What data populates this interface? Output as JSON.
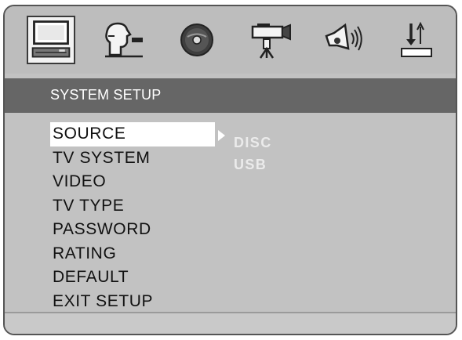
{
  "icons": [
    {
      "name": "system-monitor-icon",
      "active": true
    },
    {
      "name": "language-profile-icon",
      "active": false
    },
    {
      "name": "disc-icon",
      "active": false
    },
    {
      "name": "camera-icon",
      "active": false
    },
    {
      "name": "speaker-icon",
      "active": false
    },
    {
      "name": "sort-icon",
      "active": false
    }
  ],
  "header": {
    "title": "SYSTEM SETUP"
  },
  "menu": {
    "items": [
      {
        "label": "SOURCE",
        "selected": true
      },
      {
        "label": "TV SYSTEM"
      },
      {
        "label": "VIDEO"
      },
      {
        "label": "TV TYPE"
      },
      {
        "label": "PASSWORD"
      },
      {
        "label": "RATING"
      },
      {
        "label": "DEFAULT"
      },
      {
        "label": "EXIT SETUP"
      }
    ]
  },
  "submenu": {
    "items": [
      "DISC",
      "USB"
    ]
  },
  "colors": {
    "panel": "#c2c2c2",
    "title_bar": "#666666",
    "highlight": "#ffffff",
    "submenu_text": "#ebebeb"
  }
}
